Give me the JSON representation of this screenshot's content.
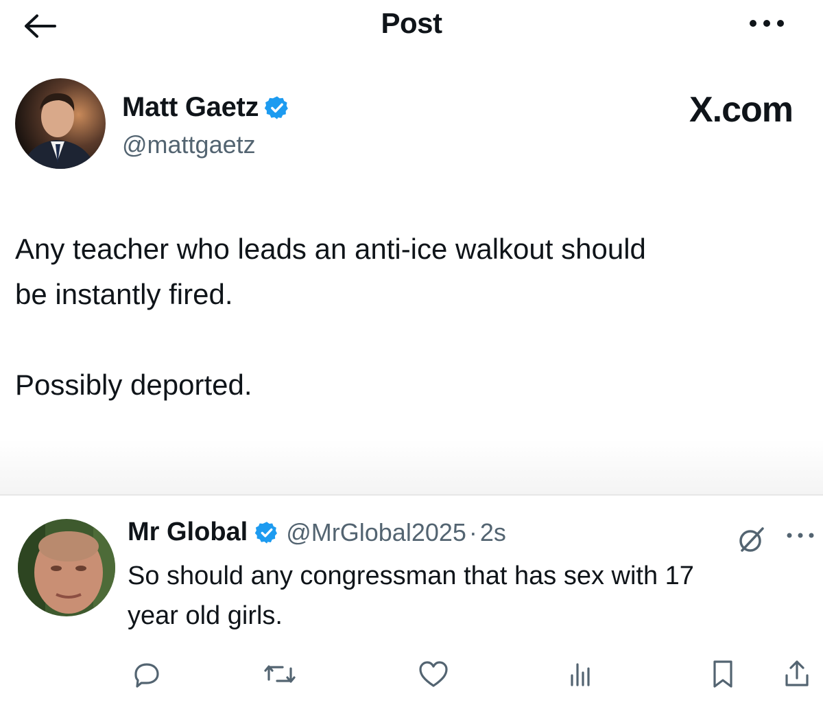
{
  "header": {
    "title": "Post",
    "back_icon": "arrow-left-icon",
    "more_icon": "more-horizontal-icon"
  },
  "post": {
    "author_name": "Matt Gaetz",
    "author_handle": "@mattgaetz",
    "verified": true,
    "watermark": "X.com",
    "text_line_1": "Any teacher who leads an anti-ice walkout should",
    "text_line_2": "be instantly fired.",
    "text_line_3": "Possibly deported."
  },
  "reply": {
    "author_name": "Mr Global",
    "author_handle": "@MrGlobal2025",
    "separator": "·",
    "time": "2s",
    "verified": true,
    "text_line_1": "So should any congressman that has sex with 17",
    "text_line_2": "year old girls.",
    "actions": [
      "reply-icon",
      "repost-icon",
      "like-icon",
      "views-icon",
      "bookmark-icon",
      "share-icon"
    ]
  },
  "colors": {
    "text": "#0f1419",
    "secondary": "#536471",
    "verified_blue": "#1d9bf0",
    "divider": "#e6e6e6"
  }
}
